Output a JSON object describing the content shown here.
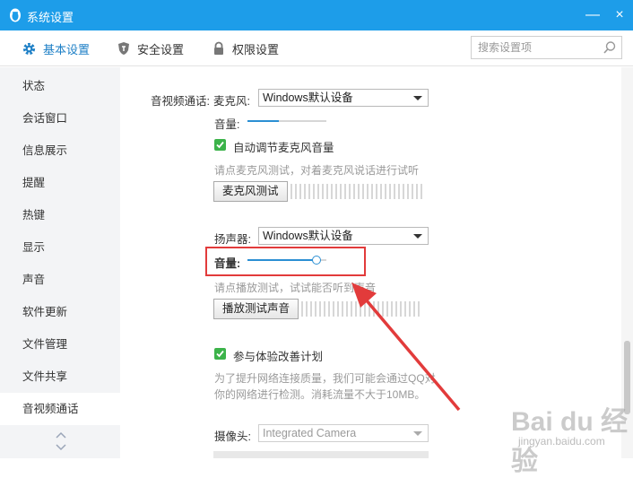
{
  "window": {
    "title": "系统设置",
    "close_glyph": "×",
    "minimize_glyph": "—"
  },
  "tabs": [
    {
      "label": "基本设置",
      "icon": "gear-icon",
      "active": true
    },
    {
      "label": "安全设置",
      "icon": "shield-icon",
      "active": false
    },
    {
      "label": "权限设置",
      "icon": "lock-icon",
      "active": false
    }
  ],
  "search": {
    "placeholder": "搜索设置项",
    "value": ""
  },
  "sidebar": {
    "items": [
      {
        "label": "状态"
      },
      {
        "label": "会话窗口"
      },
      {
        "label": "信息展示"
      },
      {
        "label": "提醒"
      },
      {
        "label": "热键"
      },
      {
        "label": "显示"
      },
      {
        "label": "声音"
      },
      {
        "label": "软件更新"
      },
      {
        "label": "文件管理"
      },
      {
        "label": "文件共享"
      },
      {
        "label": "音视频通话",
        "active": true
      }
    ]
  },
  "av": {
    "section_label": "音视频通话:",
    "mic": {
      "label": "麦克风:",
      "device": "Windows默认设备",
      "volume_label": "音量:",
      "volume_fraction": 0.4,
      "auto_adjust_label": "自动调节麦克风音量",
      "auto_adjust_checked": true,
      "hint": "请点麦克风测试，对着麦克风说话进行试听",
      "test_button": "麦克风测试"
    },
    "speaker": {
      "label": "扬声器:",
      "device": "Windows默认设备",
      "volume_label": "音量:",
      "volume_fraction": 0.88,
      "hint": "请点播放测试，试试能否听到声音",
      "test_button": "播放测试声音"
    },
    "improve": {
      "label": "参与体验改善计划",
      "checked": true,
      "desc_line1": "为了提升网络连接质量，我们可能会通过QQ对",
      "desc_line2": "你的网络进行检测。消耗流量不大于10MB。"
    },
    "camera": {
      "label": "摄像头:",
      "device": "Integrated Camera"
    }
  },
  "watermark": {
    "text": "Bai du 经验",
    "sub": "jingyan.baidu.com"
  },
  "colors": {
    "titlebar": "#1d9de9",
    "accent": "#1d7fc6",
    "check": "#3cb34a",
    "highlight": "#e23b3b"
  }
}
